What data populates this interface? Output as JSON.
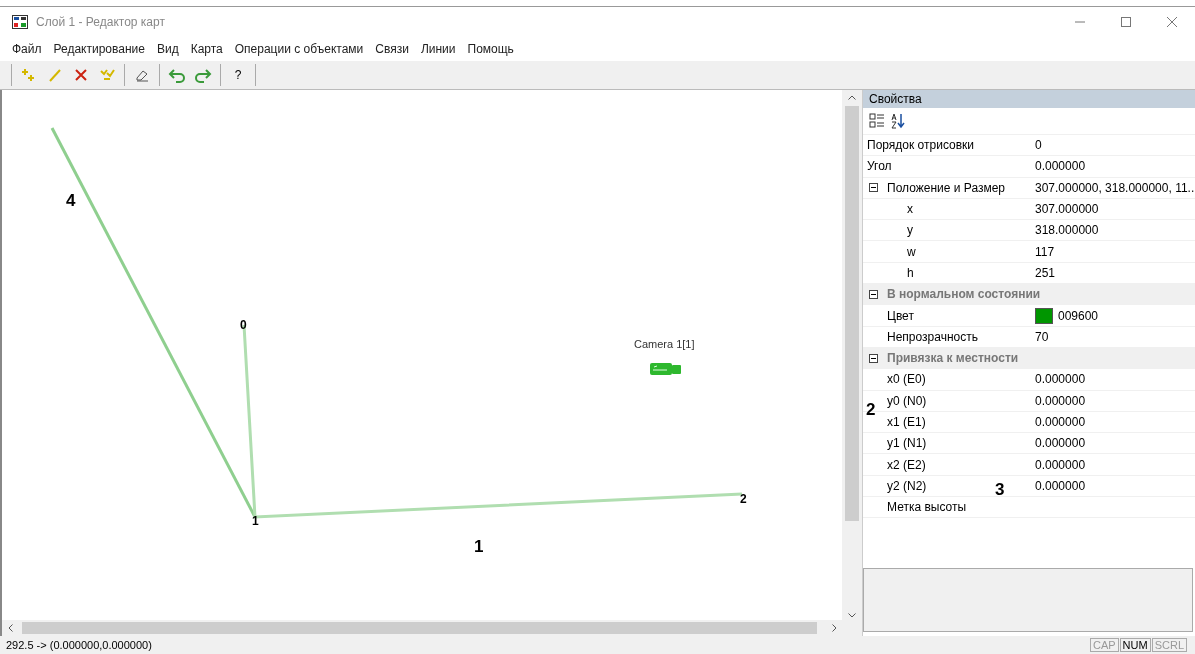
{
  "window": {
    "title": "Слой 1 - Редактор карт"
  },
  "menu": [
    "Файл",
    "Редактирование",
    "Вид",
    "Карта",
    "Операции с объектами",
    "Связи",
    "Линии",
    "Помощь"
  ],
  "toolbar": {
    "help_button": "?"
  },
  "map": {
    "nodes": [
      {
        "label": "0"
      },
      {
        "label": "1"
      },
      {
        "label": "2"
      }
    ],
    "camera": {
      "label": "Camera 1[1]"
    }
  },
  "annotations": [
    "4",
    "1",
    "2",
    "3"
  ],
  "properties": {
    "title": "Свойства",
    "rows": [
      {
        "kind": "row",
        "label": "Порядок отрисовки",
        "value": "0"
      },
      {
        "kind": "row",
        "label": "Угол",
        "value": "0.000000"
      },
      {
        "kind": "group",
        "label": "Положение и Размер",
        "value": "307.000000, 318.000000, 11..",
        "expanded": true,
        "children": [
          {
            "kind": "row",
            "label": "x",
            "value": "307.000000"
          },
          {
            "kind": "row",
            "label": "y",
            "value": "318.000000"
          },
          {
            "kind": "row",
            "label": "w",
            "value": "117"
          },
          {
            "kind": "row",
            "label": "h",
            "value": "251"
          }
        ]
      },
      {
        "kind": "category",
        "label": "В нормальном состоянии",
        "expanded": true,
        "children": [
          {
            "kind": "color",
            "label": "Цвет",
            "value": "009600",
            "color": "#009600"
          },
          {
            "kind": "row",
            "label": "Непрозрачность",
            "value": "70"
          }
        ]
      },
      {
        "kind": "category",
        "label": "Привязка к местности",
        "expanded": true,
        "children": [
          {
            "kind": "row",
            "label": "x0 (E0)",
            "value": "0.000000"
          },
          {
            "kind": "row",
            "label": "y0 (N0)",
            "value": "0.000000"
          },
          {
            "kind": "row",
            "label": "x1 (E1)",
            "value": "0.000000"
          },
          {
            "kind": "row",
            "label": "y1 (N1)",
            "value": "0.000000"
          },
          {
            "kind": "row",
            "label": "x2 (E2)",
            "value": "0.000000"
          },
          {
            "kind": "row",
            "label": "y2 (N2)",
            "value": "0.000000"
          },
          {
            "kind": "row",
            "label": "Метка высоты"
          }
        ]
      }
    ]
  },
  "status_bar": {
    "text": "292.5 -> (0.000000,0.000000)",
    "indicators": [
      {
        "label": "CAP",
        "on": false
      },
      {
        "label": "NUM",
        "on": true
      },
      {
        "label": "SCRL",
        "on": false
      }
    ]
  }
}
